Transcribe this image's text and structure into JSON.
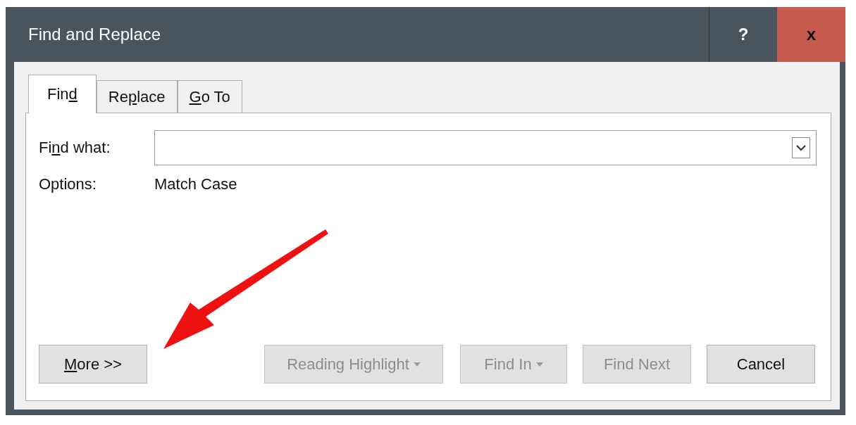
{
  "window": {
    "title": "Find and Replace",
    "help_button": "?",
    "close_button": "x"
  },
  "tabs": [
    {
      "label": [
        {
          "text": "Fin",
          "underlined": false
        },
        {
          "text": "d",
          "underlined": true
        }
      ],
      "selected": true
    },
    {
      "label": [
        {
          "text": "Re",
          "underlined": false
        },
        {
          "text": "p",
          "underlined": true
        },
        {
          "text": "lace",
          "underlined": false
        }
      ],
      "selected": false
    },
    {
      "label": [
        {
          "text": "G",
          "underlined": true
        },
        {
          "text": "o To",
          "underlined": false
        }
      ],
      "selected": false
    }
  ],
  "find_what": {
    "label": [
      {
        "text": "Fi",
        "underlined": false
      },
      {
        "text": "n",
        "underlined": true
      },
      {
        "text": "d what:",
        "underlined": false
      }
    ]
  },
  "options": {
    "label": "Options:",
    "value": "Match Case"
  },
  "buttons": [
    {
      "label": [
        {
          "text": "M",
          "underlined": true
        },
        {
          "text": "ore >>",
          "underlined": false
        }
      ],
      "disabled": false,
      "dropdown": false
    },
    {
      "label": [
        {
          "text": "Reading Highlight",
          "underlined": false
        }
      ],
      "disabled": true,
      "dropdown": true
    },
    {
      "label": [
        {
          "text": "Find In",
          "underlined": false
        }
      ],
      "disabled": true,
      "dropdown": true
    },
    {
      "label": [
        {
          "text": "Find Next",
          "underlined": false
        }
      ],
      "disabled": true,
      "dropdown": false
    },
    {
      "label": [
        {
          "text": "Cancel",
          "underlined": false
        }
      ],
      "disabled": false,
      "dropdown": false
    }
  ]
}
